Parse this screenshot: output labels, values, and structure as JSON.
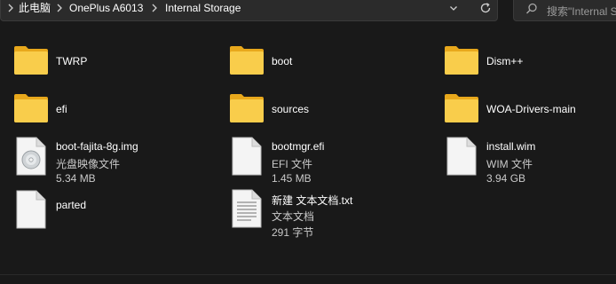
{
  "address_bar": {
    "crumbs": [
      "此电脑",
      "OnePlus A6013",
      "Internal Storage"
    ]
  },
  "search": {
    "placeholder": "搜索\"Internal St"
  },
  "items": [
    {
      "name": "TWRP",
      "type": "folder"
    },
    {
      "name": "boot",
      "type": "folder"
    },
    {
      "name": "Dism++",
      "type": "folder"
    },
    {
      "name": "efi",
      "type": "folder"
    },
    {
      "name": "sources",
      "type": "folder"
    },
    {
      "name": "WOA-Drivers-main",
      "type": "folder"
    },
    {
      "name": "boot-fajita-8g.img",
      "kind": "光盘映像文件",
      "size": "5.34 MB",
      "icon": "disc-image"
    },
    {
      "name": "bootmgr.efi",
      "kind": "EFI 文件",
      "size": "1.45 MB",
      "icon": "file"
    },
    {
      "name": "install.wim",
      "kind": "WIM 文件",
      "size": "3.94 GB",
      "icon": "file"
    },
    {
      "name": "parted",
      "type": "file",
      "icon": "file"
    },
    {
      "name": "新建 文本文档.txt",
      "kind": "文本文档",
      "size": "291 字节",
      "icon": "text-file"
    }
  ]
}
